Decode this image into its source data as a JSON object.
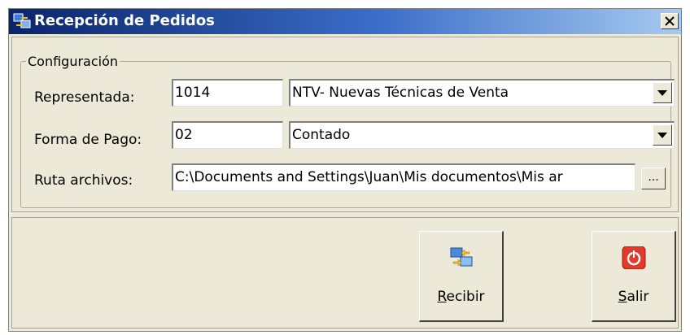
{
  "window": {
    "title": "Recepción de Pedidos",
    "close_label": "X"
  },
  "config": {
    "legend": "Configuración",
    "representada": {
      "label": "Representada:",
      "code": "1014",
      "name": "NTV- Nuevas Técnicas de Venta"
    },
    "forma_pago": {
      "label": "Forma de Pago:",
      "code": "02",
      "name": "Contado"
    },
    "ruta": {
      "label": "Ruta archivos:",
      "value": "C:\\Documents and Settings\\Juan\\Mis documentos\\Mis ar",
      "browse_label": "..."
    }
  },
  "actions": {
    "recibir": {
      "mnemonic": "R",
      "rest": "ecibir",
      "icon": "receive-transfer-icon"
    },
    "salir": {
      "mnemonic": "S",
      "rest": "alir",
      "icon": "power-icon"
    }
  },
  "colors": {
    "title_start": "#0a246a",
    "title_end": "#a6caf0",
    "face": "#ece9d8",
    "salir_icon": "#e03a2a"
  }
}
